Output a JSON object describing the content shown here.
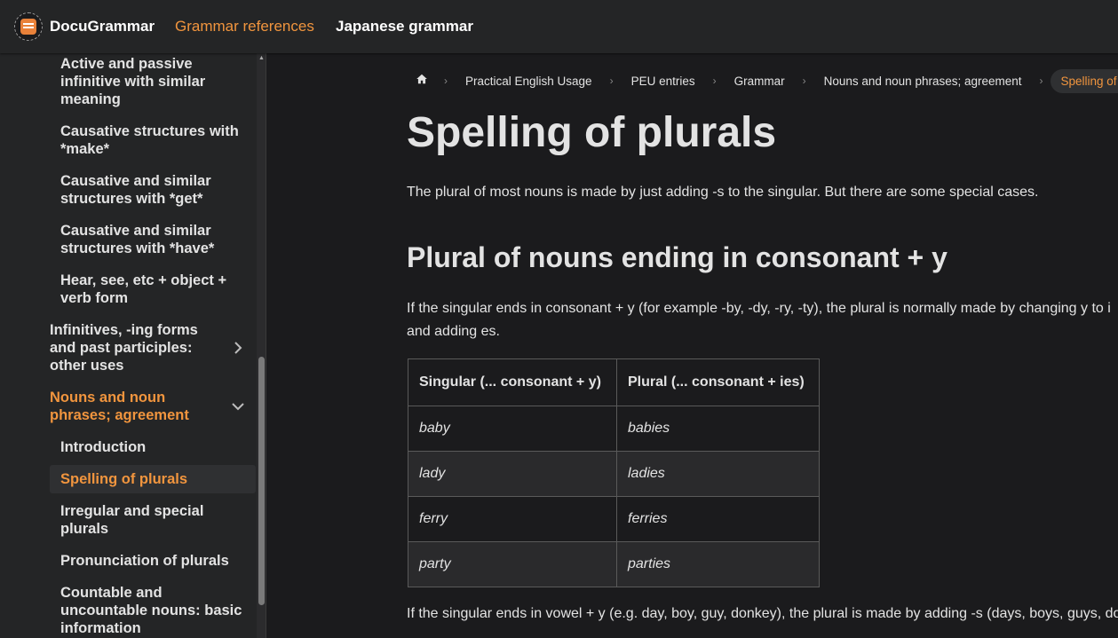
{
  "navbar": {
    "brand": "DocuGrammar",
    "links": [
      "Grammar references",
      "Japanese grammar"
    ]
  },
  "sidebar": {
    "items": [
      {
        "label": "Active and passive infinitive with similar meaning"
      },
      {
        "label": "Causative structures with *make*"
      },
      {
        "label": "Causative and similar structures with *get*"
      },
      {
        "label": "Causative and similar structures with *have*"
      },
      {
        "label": "Hear, see, etc + object + verb form"
      },
      {
        "label": "Infinitives, -ing forms and past participles: other uses"
      },
      {
        "label": "Nouns and noun phrases; agreement"
      },
      {
        "label": "Introduction"
      },
      {
        "label": "Spelling of plurals"
      },
      {
        "label": "Irregular and special plurals"
      },
      {
        "label": "Pronunciation of plurals"
      },
      {
        "label": "Countable and uncountable nouns: basic information"
      }
    ]
  },
  "breadcrumb": [
    "Practical English Usage",
    "PEU entries",
    "Grammar",
    "Nouns and noun phrases; agreement",
    "Spelling of plurals"
  ],
  "article": {
    "title": "Spelling of plurals",
    "intro": "The plural of most nouns is made by just adding -s to the singular. But there are some special cases.",
    "h2": "Plural of nouns ending in consonant + y",
    "p2": "If the singular ends in consonant + y (for example -by, -dy, -ry, -ty), the plural is normally made by changing y to i and adding es.",
    "table": {
      "headers": [
        "Singular (... consonant + y)",
        "Plural (... consonant + ies)"
      ],
      "rows": [
        [
          "baby",
          "babies"
        ],
        [
          "lady",
          "ladies"
        ],
        [
          "ferry",
          "ferries"
        ],
        [
          "party",
          "parties"
        ]
      ]
    },
    "p3": "If the singular ends in vowel + y (e.g. day, boy, guy, donkey), the plural is made by adding -s (days, boys, guys, donkeys)."
  },
  "colors": {
    "accent": "#f1953e",
    "background": "#1b1b1d",
    "panel": "#242526"
  },
  "icons": [
    "home-icon",
    "chevron-right-icon",
    "chevron-down-icon",
    "logo-icon"
  ]
}
